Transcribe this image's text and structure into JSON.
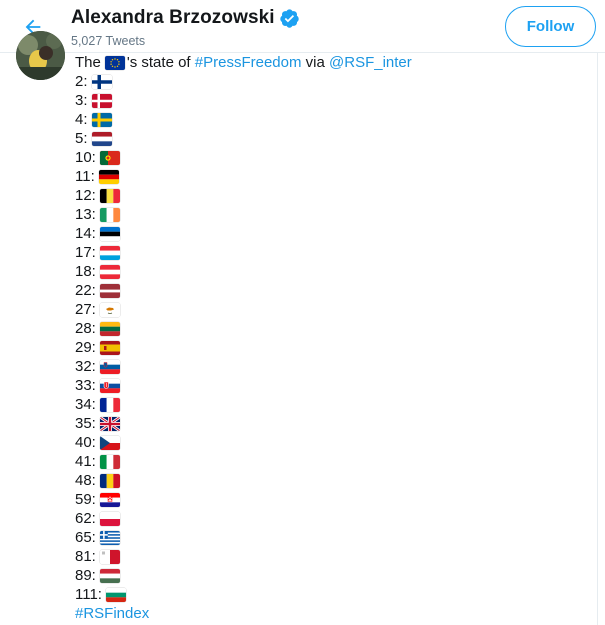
{
  "header": {
    "name": "Alexandra Brzozowski",
    "tweet_count": "5,027 Tweets",
    "follow_label": "Follow",
    "accent": "#1da1f2"
  },
  "tweet": {
    "intro_prefix": "The",
    "intro_suffix": "'s state of",
    "hashtag_press": "#PressFreedom",
    "via": "via",
    "mention": "@RSF_inter",
    "hashtag_footer": "#RSFindex",
    "rankings": [
      {
        "rank": "2:",
        "flag": "finland-flag-icon"
      },
      {
        "rank": "3:",
        "flag": "denmark-flag-icon"
      },
      {
        "rank": "4:",
        "flag": "sweden-flag-icon"
      },
      {
        "rank": "5:",
        "flag": "netherlands-flag-icon"
      },
      {
        "rank": "10:",
        "flag": "portugal-flag-icon"
      },
      {
        "rank": "11:",
        "flag": "germany-flag-icon"
      },
      {
        "rank": "12:",
        "flag": "belgium-flag-icon"
      },
      {
        "rank": "13:",
        "flag": "ireland-flag-icon"
      },
      {
        "rank": "14:",
        "flag": "estonia-flag-icon"
      },
      {
        "rank": "17:",
        "flag": "luxembourg-flag-icon"
      },
      {
        "rank": "18:",
        "flag": "austria-flag-icon"
      },
      {
        "rank": "22:",
        "flag": "latvia-flag-icon"
      },
      {
        "rank": "27:",
        "flag": "cyprus-flag-icon"
      },
      {
        "rank": "28:",
        "flag": "lithuania-flag-icon"
      },
      {
        "rank": "29:",
        "flag": "spain-flag-icon"
      },
      {
        "rank": "32:",
        "flag": "slovenia-flag-icon"
      },
      {
        "rank": "33:",
        "flag": "slovakia-flag-icon"
      },
      {
        "rank": "34:",
        "flag": "france-flag-icon"
      },
      {
        "rank": "35:",
        "flag": "united-kingdom-flag-icon"
      },
      {
        "rank": "40:",
        "flag": "czechia-flag-icon"
      },
      {
        "rank": "41:",
        "flag": "italy-flag-icon"
      },
      {
        "rank": "48:",
        "flag": "romania-flag-icon"
      },
      {
        "rank": "59:",
        "flag": "croatia-flag-icon"
      },
      {
        "rank": "62:",
        "flag": "poland-flag-icon"
      },
      {
        "rank": "65:",
        "flag": "greece-flag-icon"
      },
      {
        "rank": "81:",
        "flag": "malta-flag-icon"
      },
      {
        "rank": "89:",
        "flag": "hungary-flag-icon"
      },
      {
        "rank": "111:",
        "flag": "bulgaria-flag-icon"
      }
    ]
  }
}
